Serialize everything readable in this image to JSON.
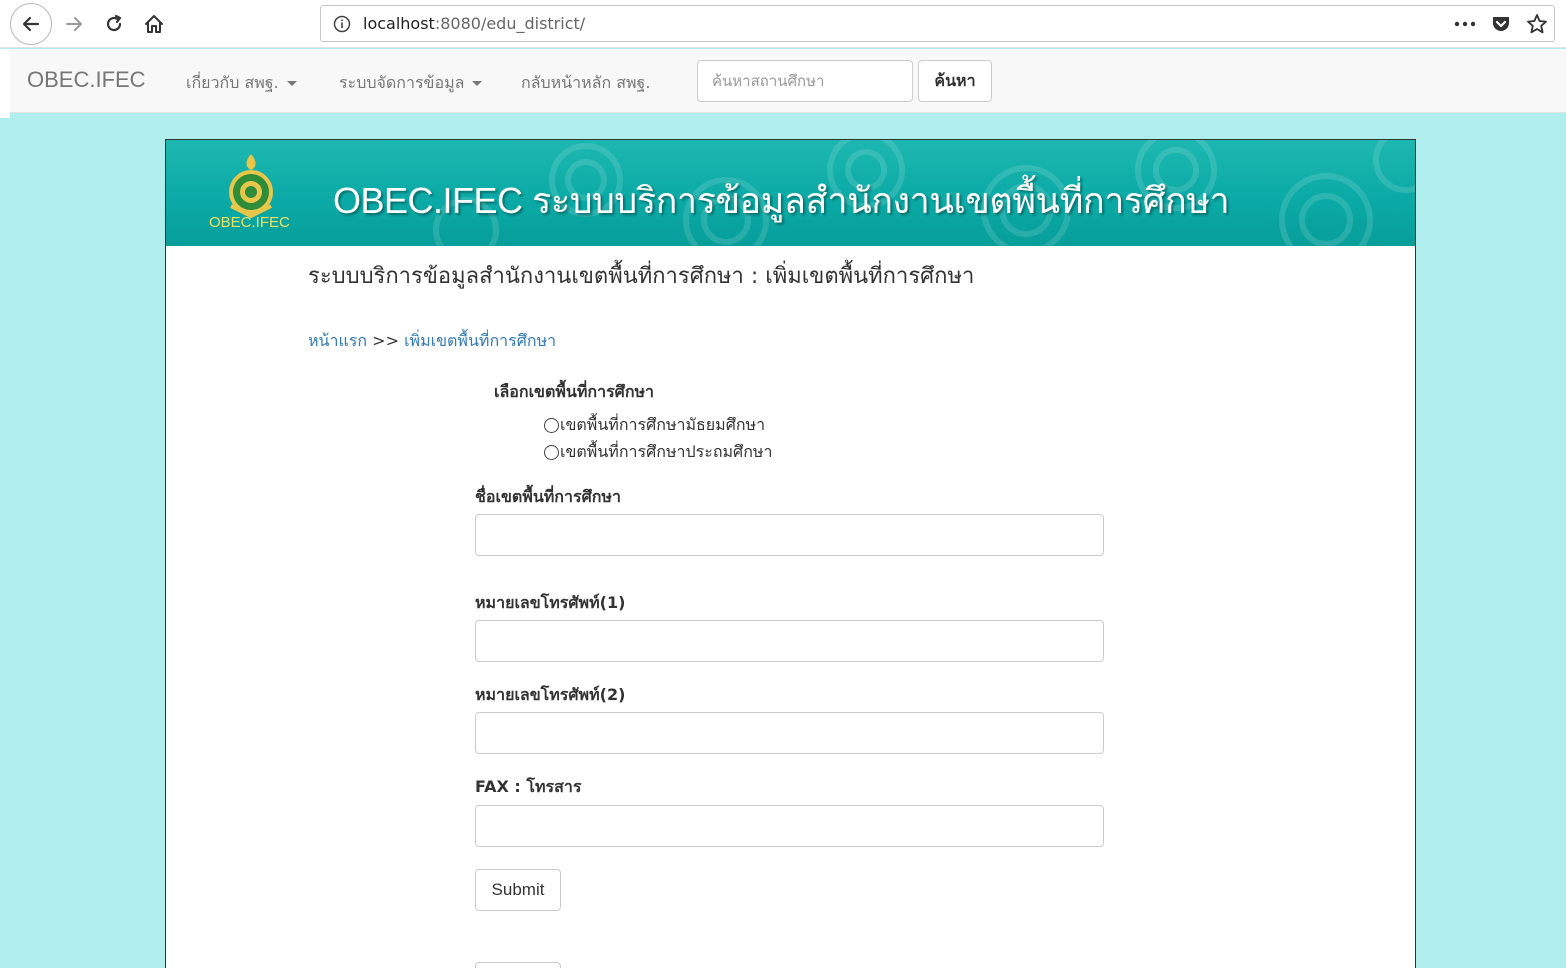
{
  "browser": {
    "url_host": "localhost",
    "url_rest": ":8080/edu_district/"
  },
  "navbar": {
    "brand": "OBEC.IFEC",
    "menu_about": "เกี่ยวกับ สพฐ.",
    "menu_data": "ระบบจัดการข้อมูล",
    "menu_home": "กลับหน้าหลัก สพฐ.",
    "search_placeholder": "ค้นหาสถานศึกษา",
    "search_button": "ค้นหา"
  },
  "banner": {
    "logo_text": "OBEC.IFEC",
    "title": "OBEC.IFEC ระบบบริการข้อมูลสำนักงานเขตพื้นที่การศึกษา"
  },
  "page": {
    "heading": "ระบบบริการข้อมูลสำนักงานเขตพื้นที่การศึกษา : เพิ่มเขตพื้นที่การศึกษา",
    "breadcrumb": {
      "home": "หน้าแรก",
      "separator": ">>",
      "current": "เพิ่มเขตพื้นที่การศึกษา"
    }
  },
  "form": {
    "district_type_label": "เลือกเขตพื้นที่การศึกษา",
    "option_secondary": "เขตพื้นที่การศึกษามัธยมศึกษา",
    "option_primary": "เขตพื้นที่การศึกษาประถมศึกษา",
    "name_label": "ชื่อเขตพื้นที่การศึกษา",
    "phone1_label": "หมายเลขโทรศัพท์(1)",
    "phone2_label": "หมายเลขโทรศัพท์(2)",
    "fax_label": "FAX : โทรสาร",
    "submit_label": "Submit"
  },
  "colors": {
    "page_bg": "#b0eeed",
    "banner_bg": "#0aa9a5",
    "link": "#337ab7"
  }
}
